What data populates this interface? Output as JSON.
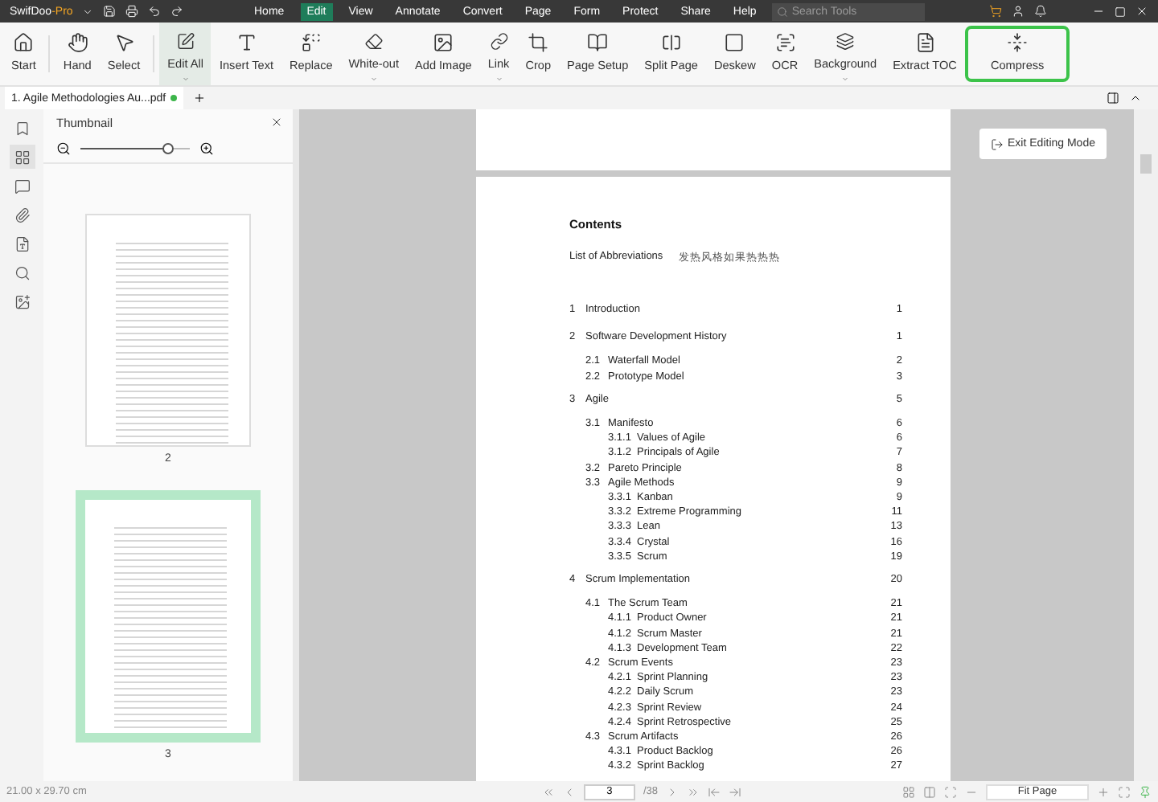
{
  "app": {
    "name": "SwifDoo",
    "edition": "-Pro"
  },
  "menu": [
    {
      "label": "Home",
      "selected": false
    },
    {
      "label": "Edit",
      "selected": true
    },
    {
      "label": "View",
      "selected": false
    },
    {
      "label": "Annotate",
      "selected": false
    },
    {
      "label": "Convert",
      "selected": false
    },
    {
      "label": "Page",
      "selected": false
    },
    {
      "label": "Form",
      "selected": false
    },
    {
      "label": "Protect",
      "selected": false
    },
    {
      "label": "Share",
      "selected": false
    },
    {
      "label": "Help",
      "selected": false
    }
  ],
  "search": {
    "placeholder": "Search Tools"
  },
  "toolbar": [
    {
      "label": "Start",
      "selected": false,
      "dropdown": false,
      "highlighted": false
    },
    {
      "label": "Hand",
      "selected": false,
      "dropdown": false,
      "highlighted": false
    },
    {
      "label": "Select",
      "selected": false,
      "dropdown": false,
      "highlighted": false
    },
    {
      "label": "Edit All",
      "selected": true,
      "dropdown": true,
      "highlighted": false
    },
    {
      "label": "Insert Text",
      "selected": false,
      "dropdown": false,
      "highlighted": false
    },
    {
      "label": "Replace",
      "selected": false,
      "dropdown": false,
      "highlighted": false
    },
    {
      "label": "White-out",
      "selected": false,
      "dropdown": true,
      "highlighted": false
    },
    {
      "label": "Add Image",
      "selected": false,
      "dropdown": false,
      "highlighted": false
    },
    {
      "label": "Link",
      "selected": false,
      "dropdown": true,
      "highlighted": false
    },
    {
      "label": "Crop",
      "selected": false,
      "dropdown": false,
      "highlighted": false
    },
    {
      "label": "Page Setup",
      "selected": false,
      "dropdown": false,
      "highlighted": false
    },
    {
      "label": "Split Page",
      "selected": false,
      "dropdown": false,
      "highlighted": false
    },
    {
      "label": "Deskew",
      "selected": false,
      "dropdown": false,
      "highlighted": false
    },
    {
      "label": "OCR",
      "selected": false,
      "dropdown": false,
      "highlighted": false
    },
    {
      "label": "Background",
      "selected": false,
      "dropdown": true,
      "highlighted": false
    },
    {
      "label": "Extract TOC",
      "selected": false,
      "dropdown": false,
      "highlighted": false
    },
    {
      "label": "Compress",
      "selected": false,
      "dropdown": false,
      "highlighted": true
    }
  ],
  "document_tab": {
    "title": "1. Agile Methodologies Au...pdf",
    "saved": true
  },
  "sidebar": {
    "items": [
      {
        "selected": false
      },
      {
        "selected": true
      },
      {
        "selected": false
      },
      {
        "selected": false
      },
      {
        "selected": false
      },
      {
        "selected": false
      },
      {
        "selected": false
      }
    ]
  },
  "thumbnail_panel": {
    "title": "Thumbnail",
    "zoom": {
      "level": 0.8
    },
    "pages": [
      {
        "label": "2",
        "selected": false
      },
      {
        "label": "3",
        "selected": true
      }
    ]
  },
  "exit_button": {
    "label": "Exit Editing Mode"
  },
  "document": {
    "heading": "Contents",
    "abbreviations": {
      "label": "List of Abbreviations",
      "text": "发热风格如果热热热"
    },
    "toc": [
      {
        "number": "1",
        "title": "Introduction",
        "page": "1"
      },
      {
        "number": "2",
        "title": "Software Development History",
        "page": "1",
        "children": [
          {
            "number": "2.1",
            "title": "Waterfall Model",
            "page": "2"
          },
          {
            "number": "2.2",
            "title": "Prototype Model",
            "page": "3"
          }
        ]
      },
      {
        "number": "3",
        "title": "Agile",
        "page": "5",
        "children": [
          {
            "number": "3.1",
            "title": "Manifesto",
            "page": "6",
            "children": [
              {
                "number": "3.1.1",
                "title": "Values of Agile",
                "page": "6"
              },
              {
                "number": "3.1.2",
                "title": "Principals of Agile",
                "page": "7"
              }
            ]
          },
          {
            "number": "3.2",
            "title": "Pareto Principle",
            "page": "8"
          },
          {
            "number": "3.3",
            "title": "Agile Methods",
            "page": "9",
            "children": [
              {
                "number": "3.3.1",
                "title": "Kanban",
                "page": "9"
              },
              {
                "number": "3.3.2",
                "title": "Extreme Programming",
                "page": "11"
              },
              {
                "number": "3.3.3",
                "title": "Lean",
                "page": "13"
              },
              {
                "number": "3.3.4",
                "title": "Crystal",
                "page": "16"
              },
              {
                "number": "3.3.5",
                "title": "Scrum",
                "page": "19"
              }
            ]
          }
        ]
      },
      {
        "number": "4",
        "title": "Scrum Implementation",
        "page": "20",
        "children": [
          {
            "number": "4.1",
            "title": "The Scrum Team",
            "page": "21",
            "children": [
              {
                "number": "4.1.1",
                "title": "Product Owner",
                "page": "21"
              },
              {
                "number": "4.1.2",
                "title": "Scrum Master",
                "page": "21"
              },
              {
                "number": "4.1.3",
                "title": "Development Team",
                "page": "22"
              }
            ]
          },
          {
            "number": "4.2",
            "title": "Scrum Events",
            "page": "23",
            "children": [
              {
                "number": "4.2.1",
                "title": "Sprint Planning",
                "page": "23"
              },
              {
                "number": "4.2.2",
                "title": "Daily Scrum",
                "page": "23"
              },
              {
                "number": "4.2.3",
                "title": "Sprint Review",
                "page": "24"
              },
              {
                "number": "4.2.4",
                "title": "Sprint Retrospective",
                "page": "25"
              }
            ]
          },
          {
            "number": "4.3",
            "title": "Scrum Artifacts",
            "page": "26",
            "children": [
              {
                "number": "4.3.1",
                "title": "Product Backlog",
                "page": "26"
              },
              {
                "number": "4.3.2",
                "title": "Sprint Backlog",
                "page": "27"
              }
            ]
          }
        ]
      }
    ]
  },
  "status_bar": {
    "page_size": "21.00 x 29.70 cm",
    "current_page": "3",
    "total_pages": "/38",
    "zoom": "Fit Page"
  }
}
